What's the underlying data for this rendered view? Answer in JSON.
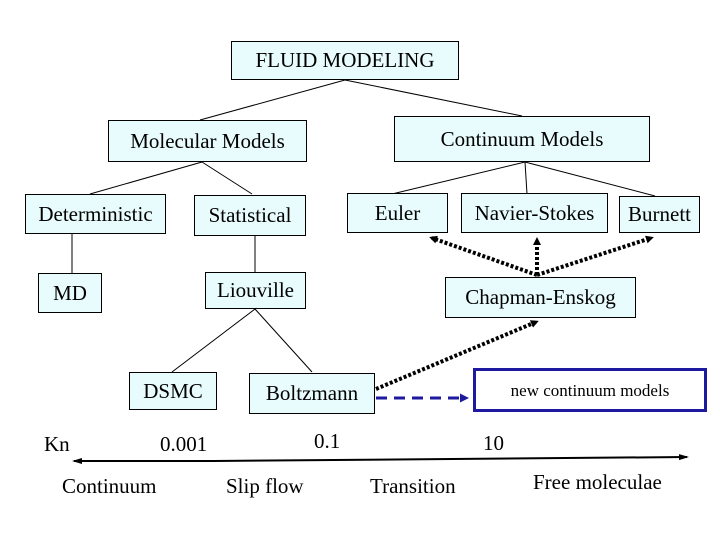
{
  "diagram": {
    "root": "FLUID MODELING",
    "categories": {
      "molecular": "Molecular Models",
      "continuum": "Continuum Models"
    },
    "molecular_children": {
      "deterministic": "Deterministic",
      "statistical": "Statistical"
    },
    "continuum_children": {
      "euler": "Euler",
      "navier_stokes": "Navier-Stokes",
      "burnett": "Burnett"
    },
    "deterministic_children": {
      "md": "MD"
    },
    "statistical_children": {
      "liouville": "Liouville"
    },
    "liouville_children": {
      "dsmc": "DSMC",
      "boltzmann": "Boltzmann"
    },
    "chapman_enskog": "Chapman-Enskog",
    "new_models": "new continuum models",
    "colors": {
      "box_fill": "#e8fbfd",
      "new_models_border": "#1e1aa0",
      "dashed_arrow": "#1e1aa0",
      "dotted_arrow": "#000000"
    }
  },
  "knudsen_axis": {
    "axis_label": "Kn",
    "ticks": [
      "0.001",
      "0.1",
      "10"
    ],
    "regimes": [
      "Continuum",
      "Slip flow",
      "Transition",
      "Free moleculae"
    ]
  }
}
